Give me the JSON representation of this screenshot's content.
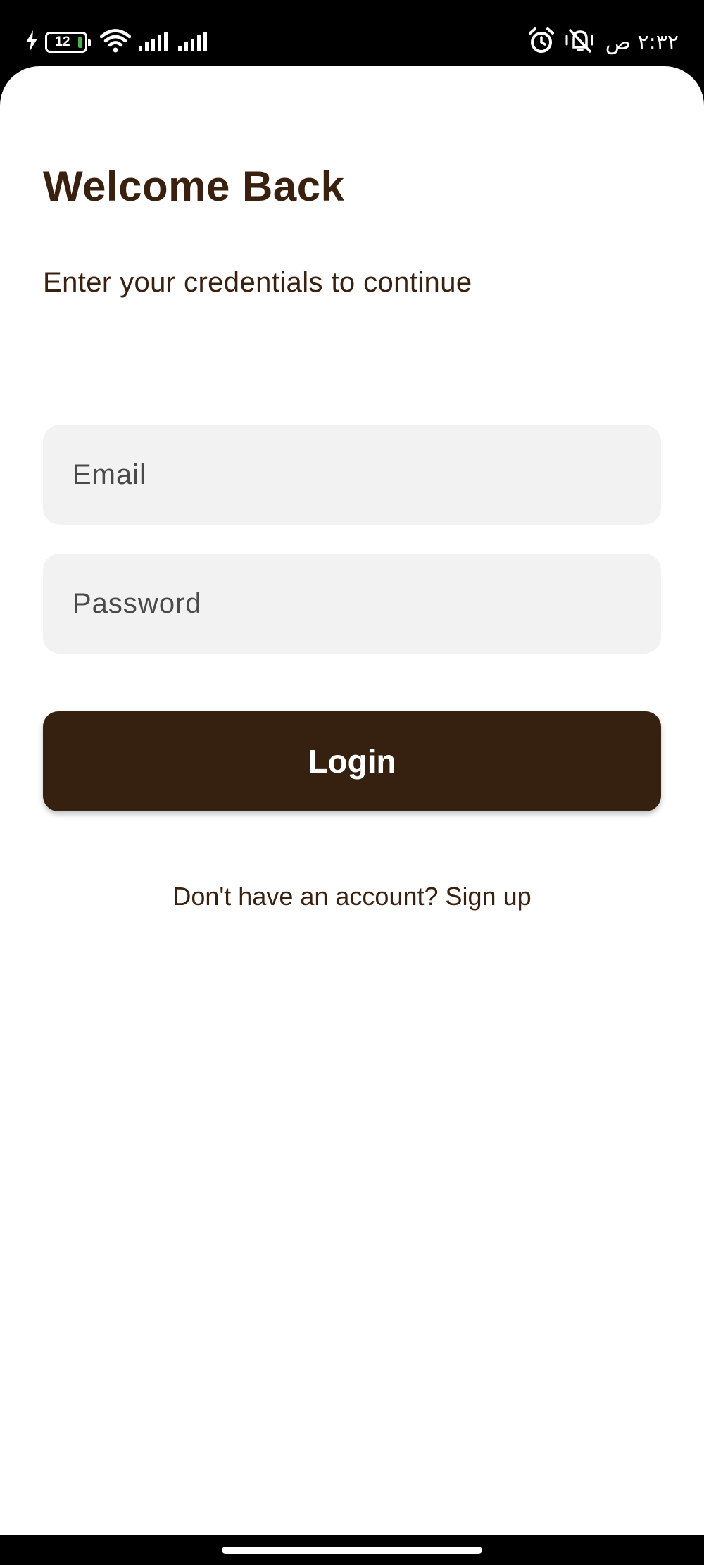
{
  "status_bar": {
    "battery_level": "12",
    "clock": "٢:٣٢ ص",
    "icons_left": [
      "charging-icon",
      "battery-icon",
      "wifi-icon",
      "signal-icon",
      "signal-icon"
    ],
    "icons_right": [
      "alarm-icon",
      "vibrate-mute-icon"
    ]
  },
  "login": {
    "title": "Welcome Back",
    "subtitle": "Enter your credentials to continue",
    "email_placeholder": "Email",
    "email_value": "",
    "password_placeholder": "Password",
    "password_value": "",
    "login_label": "Login",
    "signup_text": "Don't have an account? Sign up"
  },
  "colors": {
    "primary": "#36200f",
    "text": "#3a200f",
    "field_bg": "#f2f2f2"
  }
}
